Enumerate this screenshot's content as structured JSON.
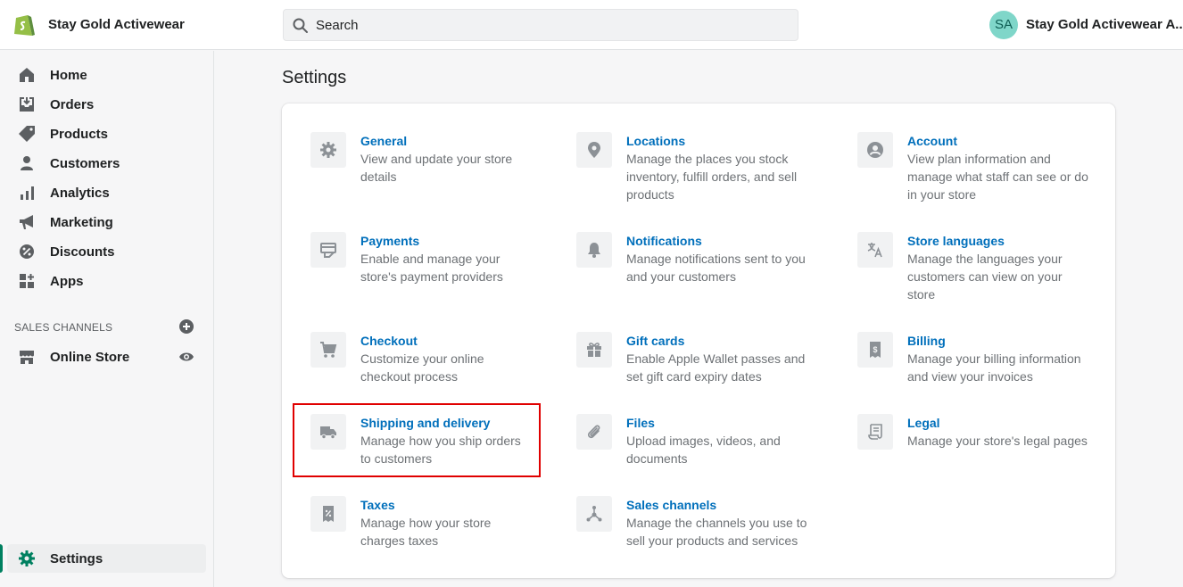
{
  "header": {
    "store_name": "Stay Gold Activewear",
    "search_placeholder": "Search",
    "avatar_initials": "SA",
    "account_name": "Stay Gold Activewear A..."
  },
  "sidebar": {
    "items": [
      {
        "label": "Home",
        "icon": "home-icon"
      },
      {
        "label": "Orders",
        "icon": "orders-icon"
      },
      {
        "label": "Products",
        "icon": "tag-icon"
      },
      {
        "label": "Customers",
        "icon": "person-icon"
      },
      {
        "label": "Analytics",
        "icon": "bar-chart-icon"
      },
      {
        "label": "Marketing",
        "icon": "megaphone-icon"
      },
      {
        "label": "Discounts",
        "icon": "discount-icon"
      },
      {
        "label": "Apps",
        "icon": "apps-icon"
      }
    ],
    "sales_channels_label": "SALES CHANNELS",
    "online_store_label": "Online Store",
    "settings_label": "Settings"
  },
  "main": {
    "title": "Settings",
    "tiles": [
      {
        "title": "General",
        "desc": "View and update your store details",
        "icon": "gear-icon"
      },
      {
        "title": "Locations",
        "desc": "Manage the places you stock inventory, fulfill orders, and sell products",
        "icon": "location-pin-icon"
      },
      {
        "title": "Account",
        "desc": "View plan information and manage what staff can see or do in your store",
        "icon": "account-icon"
      },
      {
        "title": "Payments",
        "desc": "Enable and manage your store's payment providers",
        "icon": "payments-icon"
      },
      {
        "title": "Notifications",
        "desc": "Manage notifications sent to you and your customers",
        "icon": "bell-icon"
      },
      {
        "title": "Store languages",
        "desc": "Manage the languages your customers can view on your store",
        "icon": "translate-icon"
      },
      {
        "title": "Checkout",
        "desc": "Customize your online checkout process",
        "icon": "cart-icon"
      },
      {
        "title": "Gift cards",
        "desc": "Enable Apple Wallet passes and set gift card expiry dates",
        "icon": "gift-icon"
      },
      {
        "title": "Billing",
        "desc": "Manage your billing information and view your invoices",
        "icon": "billing-icon"
      },
      {
        "title": "Shipping and delivery",
        "desc": "Manage how you ship orders to customers",
        "icon": "truck-icon"
      },
      {
        "title": "Files",
        "desc": "Upload images, videos, and documents",
        "icon": "paperclip-icon"
      },
      {
        "title": "Legal",
        "desc": "Manage your store's legal pages",
        "icon": "legal-icon"
      },
      {
        "title": "Taxes",
        "desc": "Manage how your store charges taxes",
        "icon": "taxes-icon"
      },
      {
        "title": "Sales channels",
        "desc": "Manage the channels you use to sell your products and services",
        "icon": "channels-icon"
      }
    ]
  },
  "colors": {
    "link": "#006fbb",
    "brand_green": "#008060",
    "highlight": "#e00000"
  }
}
